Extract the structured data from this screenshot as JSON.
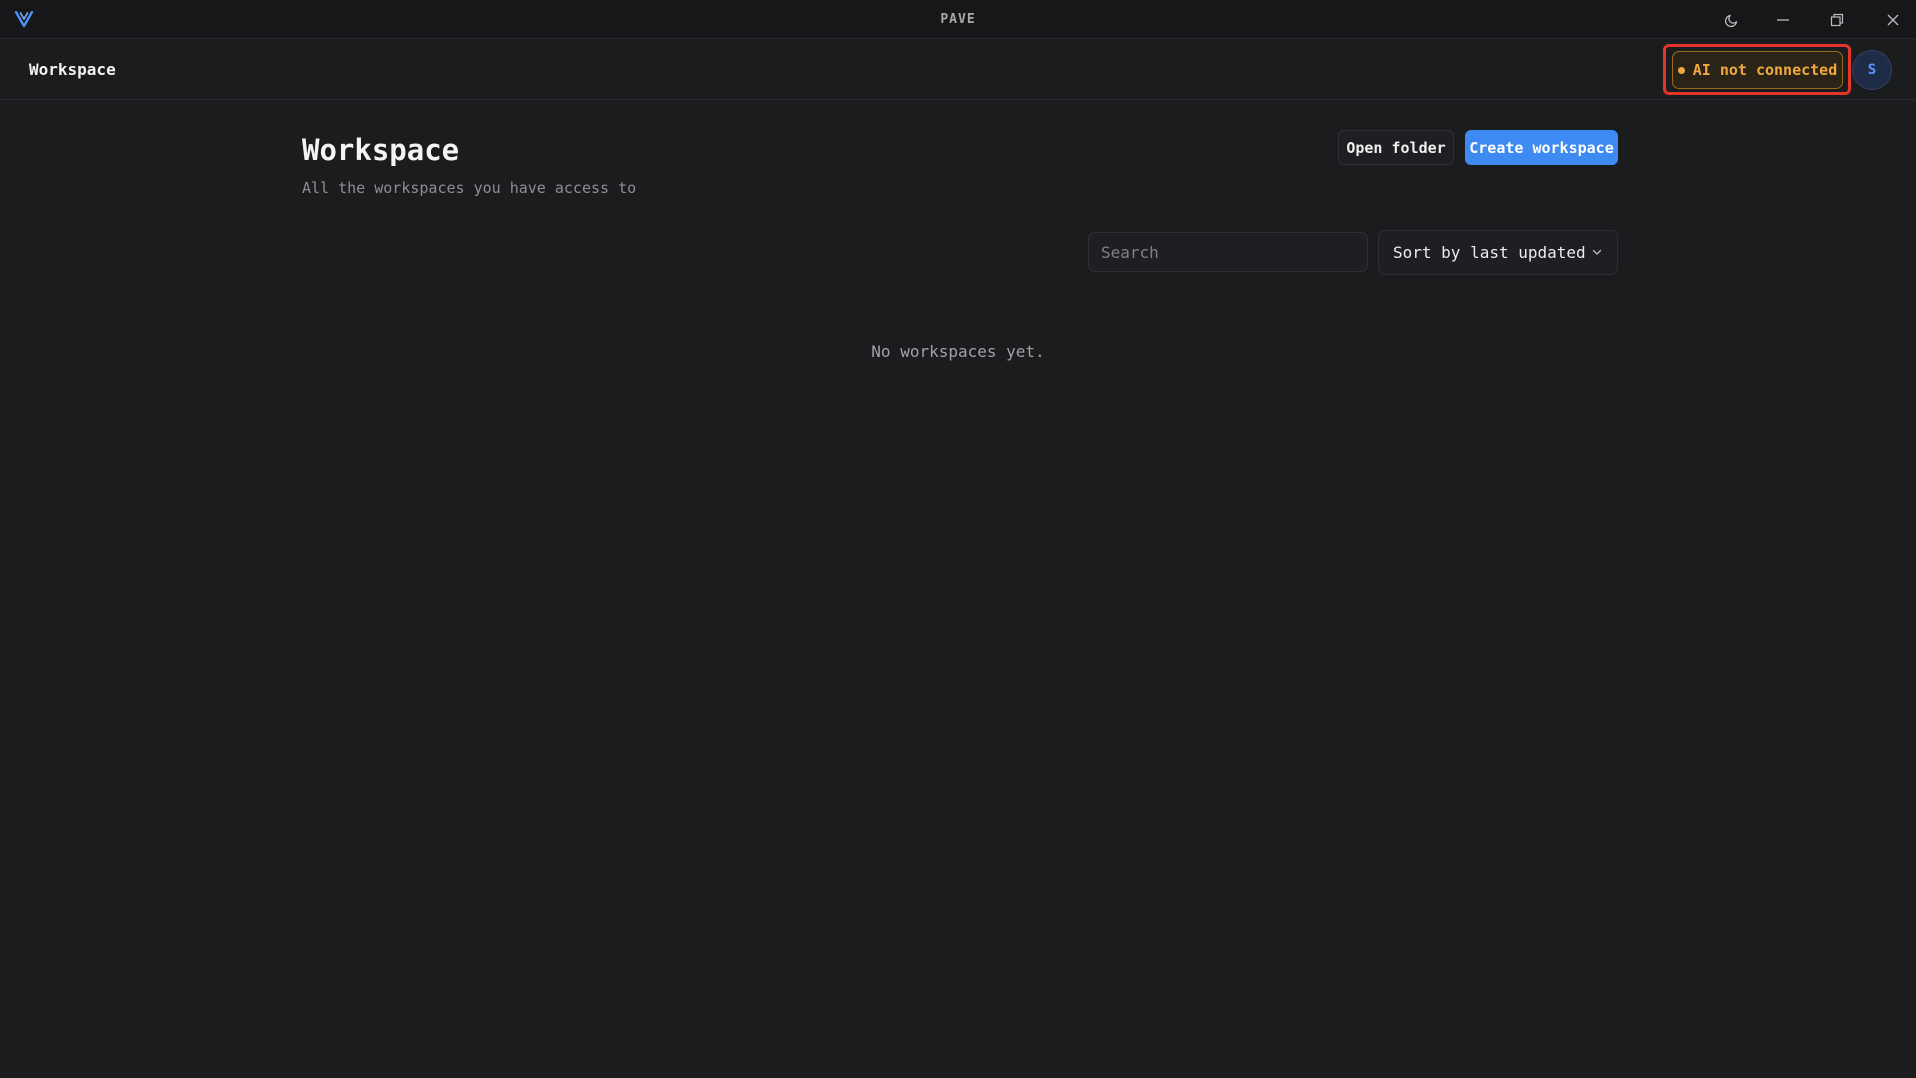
{
  "window": {
    "title": "PAVE",
    "logo_icon": "app-logo-v-icon",
    "controls": [
      "theme-moon-icon",
      "minimize-icon",
      "restore-icon",
      "close-icon"
    ]
  },
  "header": {
    "title": "Workspace",
    "ai_status": {
      "label": "AI not connected",
      "color": "#f2a93b",
      "highlighted": true
    },
    "avatar": {
      "initial": "S"
    }
  },
  "main": {
    "title": "Workspace",
    "subtitle": "All the workspaces you have access to",
    "actions": {
      "open_folder_label": "Open folder",
      "create_workspace_label": "Create workspace"
    },
    "search": {
      "placeholder": "Search",
      "value": ""
    },
    "sort": {
      "selected": "Sort by last updated"
    },
    "empty_message": "No workspaces yet."
  },
  "colors": {
    "background": "#1b1c1e",
    "titlebar": "#161718",
    "accent": "#3d8bf2",
    "warning": "#f2a93b",
    "highlight_border": "#e5342b"
  }
}
